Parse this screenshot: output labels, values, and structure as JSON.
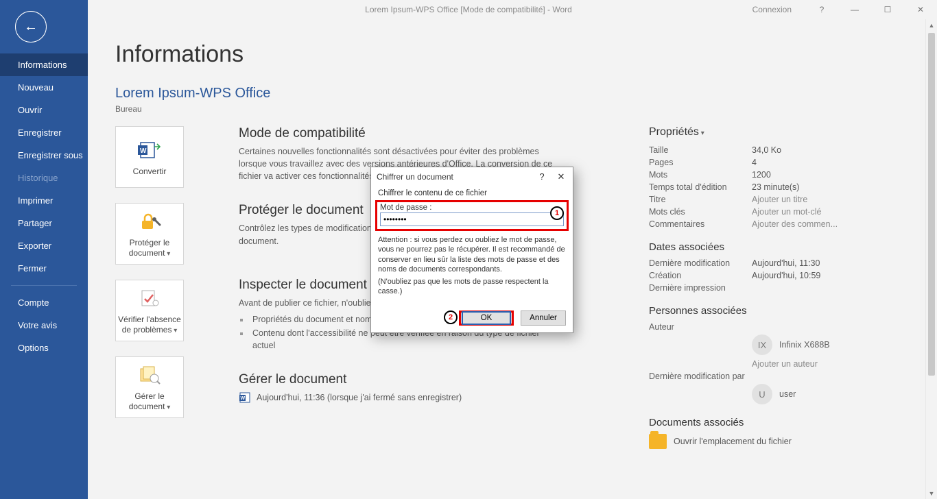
{
  "titlebar": {
    "title": "Lorem Ipsum-WPS Office [Mode de compatibilité]  -  Word",
    "signin": "Connexion"
  },
  "sidebar": {
    "items": [
      {
        "label": "Informations",
        "active": true
      },
      {
        "label": "Nouveau"
      },
      {
        "label": "Ouvrir"
      },
      {
        "label": "Enregistrer"
      },
      {
        "label": "Enregistrer sous"
      },
      {
        "label": "Historique",
        "disabled": true
      },
      {
        "label": "Imprimer"
      },
      {
        "label": "Partager"
      },
      {
        "label": "Exporter"
      },
      {
        "label": "Fermer"
      }
    ],
    "lower": [
      {
        "label": "Compte"
      },
      {
        "label": "Votre avis"
      },
      {
        "label": "Options"
      }
    ]
  },
  "page": {
    "heading": "Informations",
    "doc_title": "Lorem Ipsum-WPS Office",
    "location": "Bureau"
  },
  "sections": {
    "compat": {
      "tile": "Convertir",
      "title": "Mode de compatibilité",
      "body": "Certaines nouvelles fonctionnalités sont désactivées pour éviter des problèmes lorsque vous travaillez avec des versions antérieures d'Office. La conversion de ce fichier va activer ces fonctionnalités, mais ris..."
    },
    "protect": {
      "tile": "Protéger le document",
      "title": "Protéger le document",
      "body": "Contrôlez les types de modifications que les autres personnes peuvent apporter à ce document."
    },
    "inspect": {
      "tile": "Vérifier l'absence de problèmes",
      "title": "Inspecter le document",
      "body_lead": "Avant de publier ce fichier, n'oubliez pas qu'il contient les informations suivantes :",
      "li1": "Propriétés du document et nom de l'auteur",
      "li2": "Contenu dont l'accessibilité ne peut être vérifiée en raison du type de fichier actuel"
    },
    "manage": {
      "tile": "Gérer le document",
      "title": "Gérer le document",
      "history": "Aujourd'hui, 11:36 (lorsque j'ai fermé sans enregistrer)"
    }
  },
  "props": {
    "heading": "Propriétés",
    "size_k": "Taille",
    "size_v": "34,0 Ko",
    "pages_k": "Pages",
    "pages_v": "4",
    "words_k": "Mots",
    "words_v": "1200",
    "time_k": "Temps total d'édition",
    "time_v": "23 minute(s)",
    "title_k": "Titre",
    "title_v": "Ajouter un titre",
    "tags_k": "Mots clés",
    "tags_v": "Ajouter un mot-clé",
    "comments_k": "Commentaires",
    "comments_v": "Ajouter des commen...",
    "dates_heading": "Dates associées",
    "modified_k": "Dernière modification",
    "modified_v": "Aujourd'hui, 11:30",
    "created_k": "Création",
    "created_v": "Aujourd'hui, 10:59",
    "printed_k": "Dernière impression",
    "printed_v": "",
    "persons_heading": "Personnes associées",
    "author_k": "Auteur",
    "author_initials": "IX",
    "author_name": "Infinix X688B",
    "add_author": "Ajouter un auteur",
    "lastmodby_k": "Dernière modification par",
    "lastmodby_initials": "U",
    "lastmodby_name": "user",
    "docs_heading": "Documents associés",
    "open_location": "Ouvrir l'emplacement du fichier"
  },
  "dialog": {
    "title": "Chiffrer un document",
    "subtitle": "Chiffrer le contenu de ce fichier",
    "pw_label": "Mot de passe :",
    "pw_value": "••••••••",
    "warning": "Attention : si vous perdez ou oubliez le mot de passe, vous ne pourrez pas le récupérer. Il est recommandé de conserver en lieu sûr la liste des mots de passe et des noms de documents correspondants.",
    "note": "(N'oubliez pas que les mots de passe respectent la casse.)",
    "ok": "OK",
    "cancel": "Annuler",
    "annot1": "1",
    "annot2": "2"
  }
}
